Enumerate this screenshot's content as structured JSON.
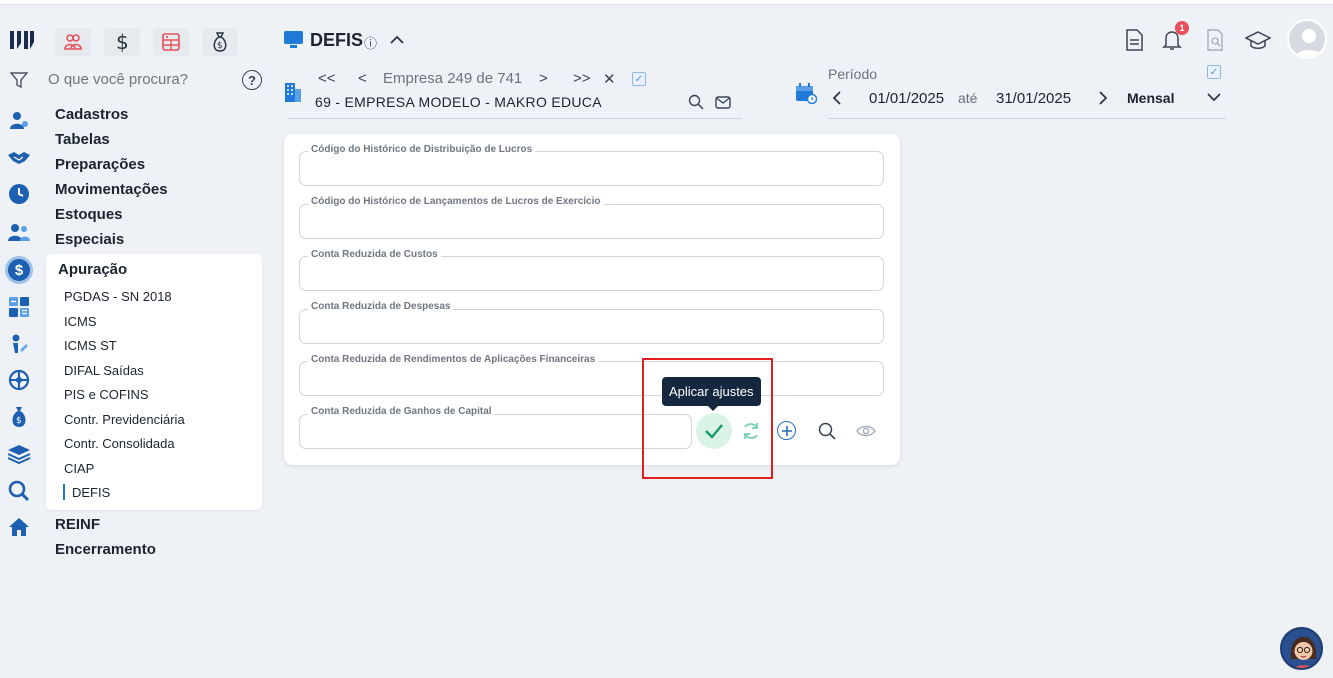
{
  "app": {
    "logo_text": "M",
    "toolbar_icons": [
      "people-icon",
      "dollar-icon",
      "calculator-icon",
      "money-bag-icon"
    ]
  },
  "search": {
    "placeholder": "O que você procura?",
    "help_symbol": "?"
  },
  "menu": {
    "items_top": [
      "Cadastros",
      "Tabelas",
      "Preparações",
      "Movimentações",
      "Estoques",
      "Especiais"
    ],
    "active_group": "Apuração",
    "sub_items": [
      "PGDAS - SN 2018",
      "ICMS",
      "ICMS ST",
      "DIFAL Saídas",
      "PIS e COFINS",
      "Contr. Previdenciária",
      "Contr. Consolidada",
      "CIAP",
      "DEFIS"
    ],
    "active_sub": "DEFIS",
    "items_bottom": [
      "REINF",
      "Encerramento"
    ]
  },
  "header": {
    "title": "DEFIS",
    "info_symbol": "ⓘ",
    "empresa_nav": {
      "first": "<<",
      "prev": "<",
      "count": "Empresa 249 de 741",
      "next": ">",
      "last": ">>",
      "close": "✕"
    },
    "empresa_name": "69 - EMPRESA MODELO - MAKRO EDUCA",
    "periodo": {
      "label": "Período",
      "start": "01/01/2025",
      "separator": "até",
      "end": "31/01/2025",
      "mode": "Mensal"
    },
    "notification_count": "1"
  },
  "form": {
    "fields": [
      {
        "label": "Código do Histórico de Distribuição de Lucros",
        "value": ""
      },
      {
        "label": "Código do Histórico de Lançamentos de Lucros de Exercício",
        "value": ""
      },
      {
        "label": "Conta Reduzida de Custos",
        "value": ""
      },
      {
        "label": "Conta Reduzida de Despesas",
        "value": ""
      },
      {
        "label": "Conta Reduzida de Rendimentos de Aplicações Financeiras",
        "value": ""
      },
      {
        "label": "Conta Reduzida de Ganhos de Capital",
        "value": ""
      }
    ],
    "tooltip": "Aplicar ajustes"
  },
  "colors": {
    "accent": "#1f74d9",
    "apply_green": "#1a9b64",
    "highlight_red": "#e02020",
    "tooltip_bg": "#15263f"
  }
}
